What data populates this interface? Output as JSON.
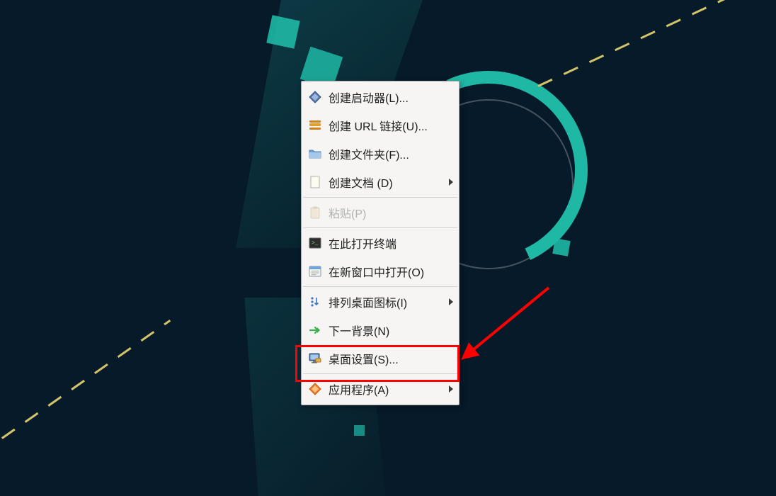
{
  "menu": {
    "items": [
      {
        "icon": "diamond-icon",
        "label": "创建启动器(L)...",
        "disabled": false,
        "submenu": false
      },
      {
        "icon": "url-link-icon",
        "label": "创建 URL 链接(U)...",
        "disabled": false,
        "submenu": false
      },
      {
        "icon": "folder-icon",
        "label": "创建文件夹(F)...",
        "disabled": false,
        "submenu": false
      },
      {
        "icon": "document-icon",
        "label": "创建文档 (D)",
        "disabled": false,
        "submenu": true
      },
      {
        "separator": true
      },
      {
        "icon": "clipboard-icon",
        "label": "粘贴(P)",
        "disabled": true,
        "submenu": false
      },
      {
        "separator": true
      },
      {
        "icon": "terminal-icon",
        "label": "在此打开终端",
        "disabled": false,
        "submenu": false
      },
      {
        "icon": "window-icon",
        "label": "在新窗口中打开(O)",
        "disabled": false,
        "submenu": false
      },
      {
        "separator": true
      },
      {
        "icon": "sort-icon",
        "label": "排列桌面图标(I)",
        "disabled": false,
        "submenu": true
      },
      {
        "icon": "next-arrow-icon",
        "label": "下一背景(N)",
        "disabled": false,
        "submenu": false
      },
      {
        "icon": "monitor-icon",
        "label": "桌面设置(S)...",
        "disabled": false,
        "submenu": false
      },
      {
        "separator": true
      },
      {
        "icon": "app-diamond-icon",
        "label": "应用程序(A)",
        "disabled": false,
        "submenu": true
      }
    ]
  },
  "annotation": {
    "highlight_target": "桌面设置(S)..."
  }
}
